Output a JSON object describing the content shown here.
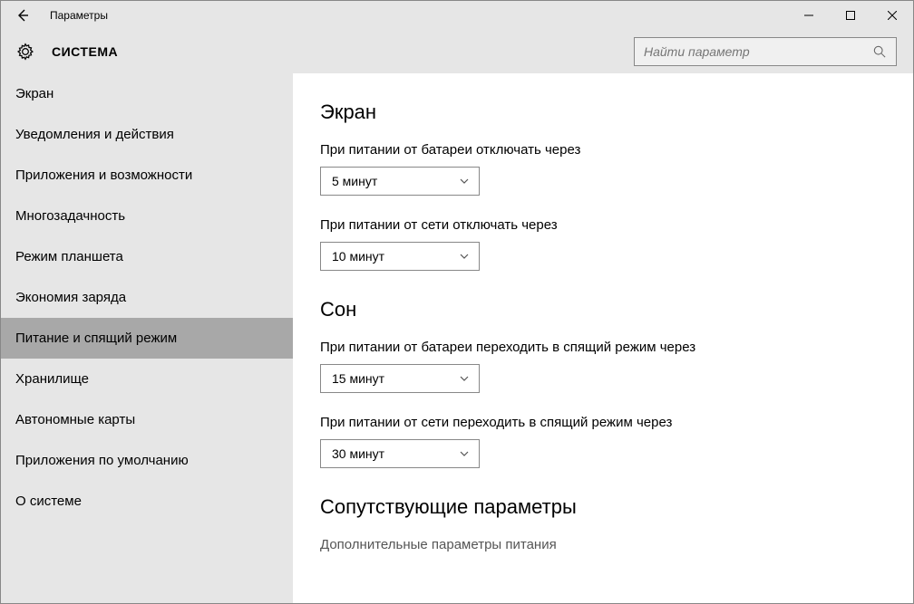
{
  "window": {
    "title": "Параметры"
  },
  "header": {
    "section": "СИСТЕМА",
    "search_placeholder": "Найти параметр"
  },
  "sidebar": {
    "items": [
      {
        "label": "Экран"
      },
      {
        "label": "Уведомления и действия"
      },
      {
        "label": "Приложения и возможности"
      },
      {
        "label": "Многозадачность"
      },
      {
        "label": "Режим планшета"
      },
      {
        "label": "Экономия заряда"
      },
      {
        "label": "Питание и спящий режим",
        "selected": true
      },
      {
        "label": "Хранилище"
      },
      {
        "label": "Автономные карты"
      },
      {
        "label": "Приложения по умолчанию"
      },
      {
        "label": "О системе"
      }
    ]
  },
  "main": {
    "screen": {
      "heading": "Экран",
      "battery_off_label": "При питании от батареи отключать через",
      "battery_off_value": "5 минут",
      "plugged_off_label": "При питании от сети отключать через",
      "plugged_off_value": "10 минут"
    },
    "sleep": {
      "heading": "Сон",
      "battery_sleep_label": "При питании от батареи переходить в спящий режим через",
      "battery_sleep_value": "15 минут",
      "plugged_sleep_label": "При питании от сети переходить в спящий режим через",
      "plugged_sleep_value": "30 минут"
    },
    "related": {
      "heading": "Сопутствующие параметры",
      "link1": "Дополнительные параметры питания"
    }
  }
}
